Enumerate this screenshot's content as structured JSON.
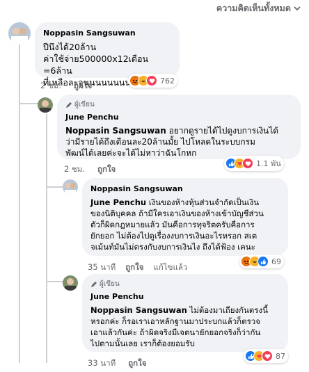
{
  "filter": {
    "label": "ความคิดเห็นทั้งหมด"
  },
  "comments": [
    {
      "name": "Noppasin Sangsuwan",
      "author_badge": "",
      "mention": "",
      "lines": [
        "ปีนึงได้20ล้าน",
        "ค่าใช้จ่าย500000x12เดือน =6ล้าน",
        "ที่เหลือละจูนนนนนนนนนน"
      ],
      "time": "2 ชม.",
      "like": "ถูกใจ",
      "edited": "",
      "reaction_count": "762",
      "reactions": [
        "angry",
        "haha",
        "love"
      ]
    },
    {
      "name": "June Penchu",
      "author_badge": "ผู้เขียน",
      "mention": "Noppasin Sangsuwan",
      "lines": [
        " อยากดูรายได้ไปดูงบการเงินได้",
        "ว่ามีรายได้ถึงเดือนละ20ล้านมั้ย ไปโหลดในระบบกรม",
        "พัฒน์ได้เลยค่ะจะได้ไม่หาว่าฉันโกหก"
      ],
      "time": "2 ชม.",
      "like": "ถูกใจ",
      "edited": "",
      "reaction_count": "1.1 พัน",
      "reactions": [
        "like",
        "care",
        "love"
      ]
    },
    {
      "name": "Noppasin Sangsuwan",
      "author_badge": "",
      "mention": "June Penchu",
      "lines": [
        " เงินของห้างหุ้นส่วนจำกัดเป็นเงิน",
        "ของนิติบุคคล ถ้ามีใครเอาเงินของห้างเข้าบัญชีส่วน",
        "ตัวก็ผิดกฎหมายแล้ว มันคือการทุจริตครับคือการ",
        "ยักยอก ไม่ต้องไปดูเรื่องงบการเงินอะไรหรอก สเต",
        "จเม้นท์มันไม่ตรงกับงบการเงินไง ถึงได้ฟ้อง เคนะ"
      ],
      "time": "35 นาที",
      "like": "ถูกใจ",
      "edited": "แก้ไขแล้ว",
      "reaction_count": "69",
      "reactions": [
        "angry",
        "haha",
        "like"
      ]
    },
    {
      "name": "June Penchu",
      "author_badge": "ผู้เขียน",
      "mention": "Noppasin Sangsuwan",
      "lines": [
        " ไม่ต้องมาเถียงกันตรงนี้",
        "หรอกค่ะ ก็รอเราเอาหลักฐานมาประบกแล้วก็ตรวจ",
        "เอาแล้วกันค่ะ ถ้าผิดจริงมีเจตนายักยอกจริงก็ว่ากัน",
        "ไปตามนั้นเลย เราก็ต้องยอมรับ"
      ],
      "time": "33 นาที",
      "like": "ถูกใจ",
      "edited": "",
      "reaction_count": "87",
      "reactions": [
        "like",
        "care",
        "love"
      ]
    }
  ],
  "colors": {
    "like": "#1877f2",
    "love": "#f33e58",
    "care": "#f7b125",
    "haha": "#f7b125",
    "angry": "#e9710f"
  }
}
